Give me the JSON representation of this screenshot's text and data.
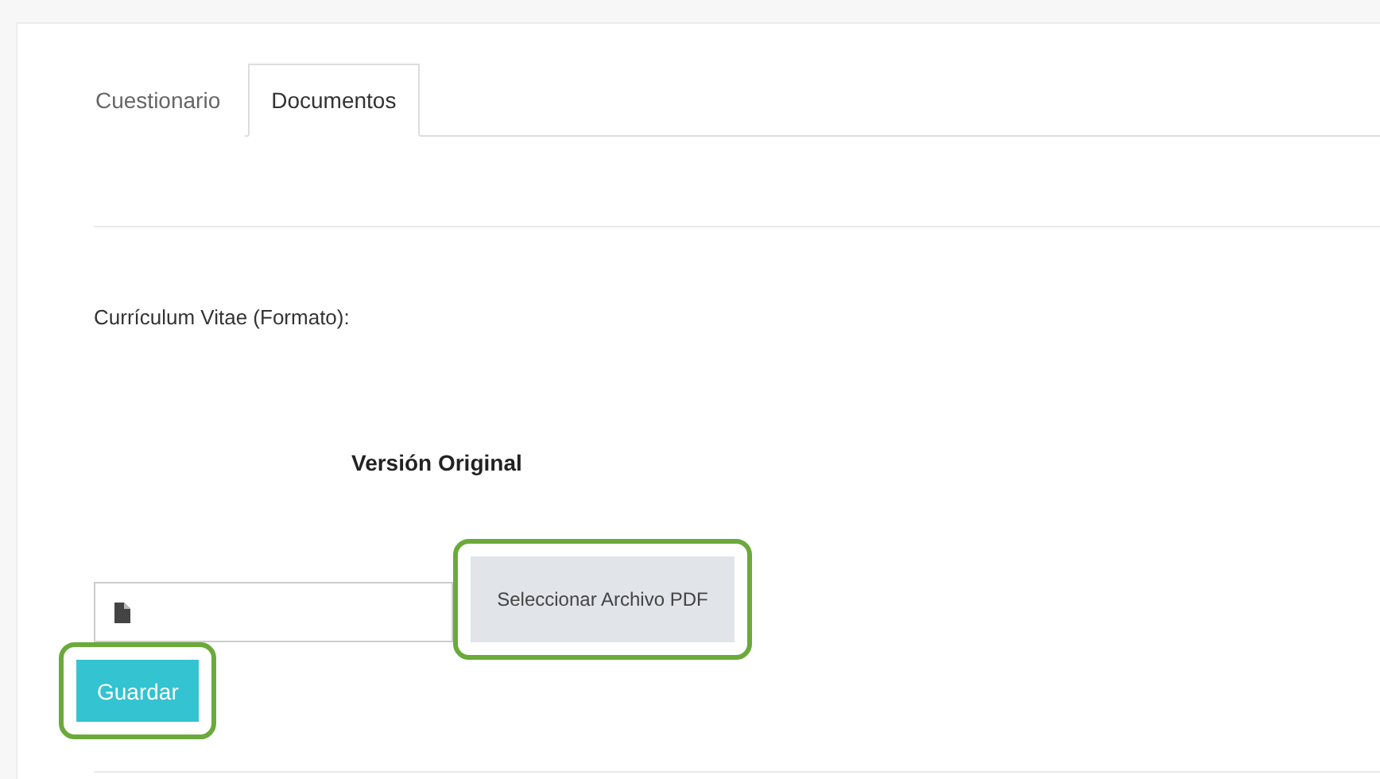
{
  "tabs": [
    {
      "label": "Cuestionario",
      "selected": false
    },
    {
      "label": "Documentos",
      "selected": true
    }
  ],
  "document": {
    "label": "Currículum Vitae (Formato):",
    "version_heading": "Versión Original",
    "select_button": {
      "label": "Seleccionar Archivo PDF",
      "highlighted": true
    }
  },
  "save_button": {
    "label": "Guardar",
    "highlighted": true
  }
}
